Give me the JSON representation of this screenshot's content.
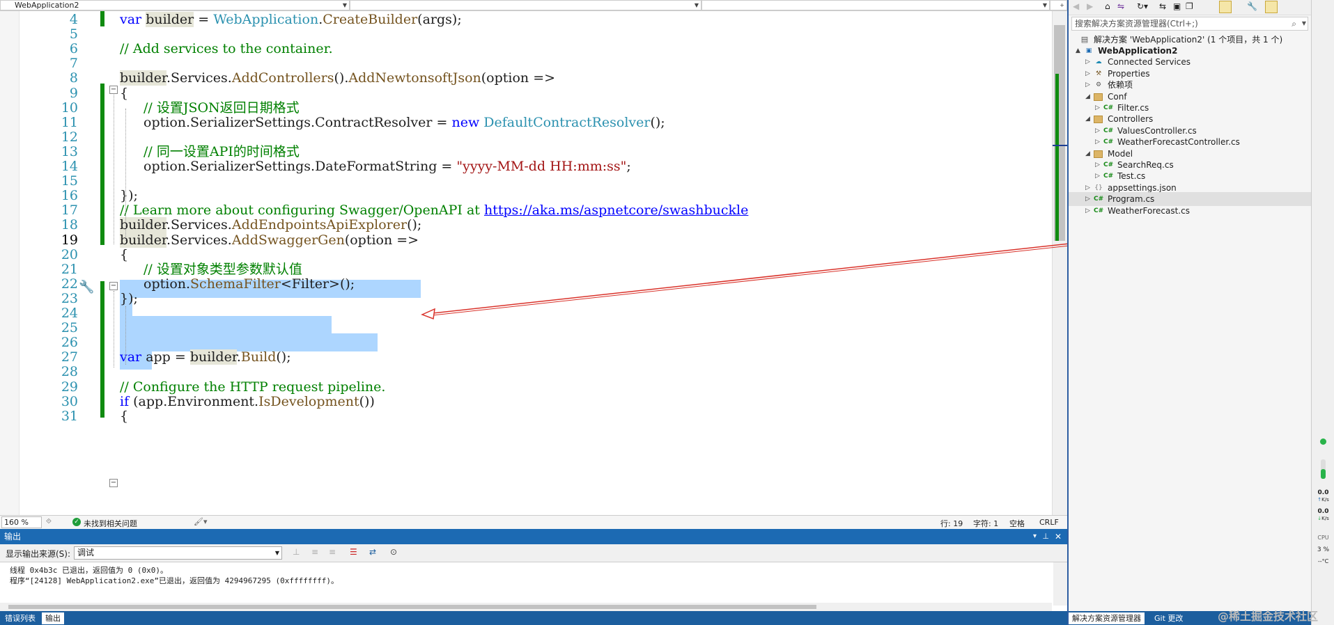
{
  "navbar": {
    "project": "WebApplication2",
    "drop2": "",
    "drop3": ""
  },
  "editor": {
    "lines": [
      {
        "n": "4",
        "parts": [
          [
            "kw",
            "var "
          ],
          [
            "hl",
            "builder"
          ],
          [
            "",
            " = "
          ],
          [
            "ty",
            "WebApplication"
          ],
          [
            "",
            ". "
          ],
          [
            "mt",
            "CreateBuilder"
          ],
          [
            "",
            "("
          ],
          [
            "",
            "args"
          ],
          [
            "",
            ");"
          ]
        ]
      },
      {
        "n": "5"
      },
      {
        "n": "6",
        "comment": "// Add services to the container."
      },
      {
        "n": "7"
      },
      {
        "n": "8",
        "text": "builder.Services.AddControllers().AddNewtonsoftJson(option =>"
      },
      {
        "n": "9",
        "text": "{"
      },
      {
        "n": "10",
        "comment": "// 设置JSON返回日期格式"
      },
      {
        "n": "11",
        "text": "option.SerializerSettings.ContractResolver = new DefaultContractResolver();"
      },
      {
        "n": "12"
      },
      {
        "n": "13",
        "comment": "// 同一设置API的时间格式"
      },
      {
        "n": "14",
        "text": "option.SerializerSettings.DateFormatString = \"yyyy-MM-dd HH:mm:ss\";"
      },
      {
        "n": "15"
      },
      {
        "n": "16",
        "text": "});"
      },
      {
        "n": "17",
        "comment": "// Learn more about configuring Swagger/OpenAPI at",
        "link": "https://aka.ms/aspnetcore/swashbuckle"
      },
      {
        "n": "18",
        "text": "builder.Services.AddEndpointsApiExplorer();"
      },
      {
        "n": "19",
        "text": "builder.Services.AddSwaggerGen(option =>"
      },
      {
        "n": "20",
        "text": "{"
      },
      {
        "n": "21",
        "comment": "// 设置对象类型参数默认值"
      },
      {
        "n": "22",
        "text": "option.SchemaFilter<Filter>();"
      },
      {
        "n": "23",
        "text": "});"
      },
      {
        "n": "24"
      },
      {
        "n": "25"
      },
      {
        "n": "26"
      },
      {
        "n": "27",
        "text": "var app = builder.Build();"
      },
      {
        "n": "28"
      },
      {
        "n": "29",
        "comment": "// Configure the HTTP request pipeline."
      },
      {
        "n": "30",
        "text": "if (app.Environment.IsDevelopment())"
      },
      {
        "n": "31",
        "text": "{"
      }
    ]
  },
  "status": {
    "zoom": "160 %",
    "issues": "未找到相关问题",
    "line": "行: 19",
    "char": "字符: 1",
    "space": "空格",
    "crlf": "CRLF"
  },
  "output": {
    "title": "输出",
    "source_label": "显示输出来源(S):",
    "source_value": "调试",
    "lines": [
      "线程 0x4b3c 已退出，返回值为 0 (0x0)。",
      "程序“[24128] WebApplication2.exe”已退出，返回值为 4294967295 (0xffffffff)。"
    ]
  },
  "bottom_tabs": [
    "错误列表",
    "输出"
  ],
  "solution": {
    "search_placeholder": "搜索解决方案资源管理器(Ctrl+;)",
    "root": "解决方案 'WebApplication2' (1 个项目，共 1 个)",
    "items": [
      {
        "label": "WebApplication2",
        "depth": 1,
        "icon": "project-icon",
        "twisty": "▲",
        "bold": true
      },
      {
        "label": "Connected Services",
        "depth": 2,
        "icon": "connected-services-icon",
        "twisty": "▷"
      },
      {
        "label": "Properties",
        "depth": 2,
        "icon": "wrench-icon",
        "twisty": "▷"
      },
      {
        "label": "依赖项",
        "depth": 2,
        "icon": "dependencies-icon",
        "twisty": "▷"
      },
      {
        "label": "Conf",
        "depth": 2,
        "icon": "folder-icon",
        "twisty": "◢"
      },
      {
        "label": "Filter.cs",
        "depth": 3,
        "icon": "csharp-file-icon",
        "twisty": "▷"
      },
      {
        "label": "Controllers",
        "depth": 2,
        "icon": "folder-icon",
        "twisty": "◢"
      },
      {
        "label": "ValuesController.cs",
        "depth": 3,
        "icon": "csharp-file-icon",
        "twisty": "▷"
      },
      {
        "label": "WeatherForecastController.cs",
        "depth": 3,
        "icon": "csharp-file-icon",
        "twisty": "▷"
      },
      {
        "label": "Model",
        "depth": 2,
        "icon": "folder-icon",
        "twisty": "◢"
      },
      {
        "label": "SearchReq.cs",
        "depth": 3,
        "icon": "csharp-file-icon",
        "twisty": "▷"
      },
      {
        "label": "Test.cs",
        "depth": 3,
        "icon": "csharp-file-icon",
        "twisty": "▷"
      },
      {
        "label": "appsettings.json",
        "depth": 2,
        "icon": "json-file-icon",
        "twisty": "▷"
      },
      {
        "label": "Program.cs",
        "depth": 2,
        "icon": "csharp-file-icon",
        "twisty": "▷",
        "selected": true
      },
      {
        "label": "WeatherForecast.cs",
        "depth": 2,
        "icon": "csharp-file-icon",
        "twisty": "▷"
      }
    ],
    "tabs": [
      "解决方案资源管理器",
      "Git 更改"
    ]
  },
  "rstrip": {
    "up": "0.0",
    "up_unit": "K/s",
    "down": "0.0",
    "down_unit": "K/s",
    "cpu": "CPU",
    "cpu_val": "3 %",
    "temp": "--°C"
  },
  "watermark": "@稀土掘金技术社区",
  "colors": {
    "accent": "#1c6ab3",
    "selection": "#add6ff",
    "change": "#108b10",
    "annotation": "#d9322a"
  }
}
